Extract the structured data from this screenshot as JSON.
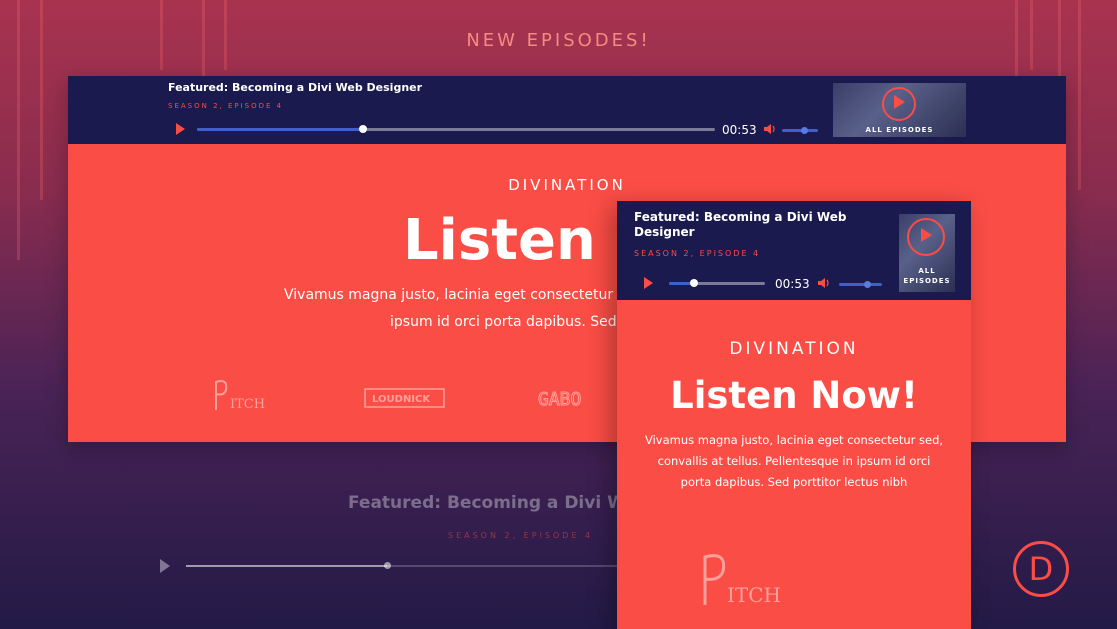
{
  "banner": {
    "title": "NEW EPISODES!"
  },
  "colors": {
    "accent": "#fa4d45",
    "player_bg": "#1a1a4e",
    "progress": "#3f5fcc"
  },
  "desktop": {
    "player": {
      "title": "Featured: Becoming a Divi Web Designer",
      "subtitle": "SEASON 2, EPISODE 4",
      "time": "00:53",
      "progress_fraction": 0.32,
      "volume_fraction": 0.6,
      "thumb_label": "ALL EPISODES"
    },
    "kicker": "DIVINATION",
    "hero": "Listen N",
    "body_line1": "Vivamus magna justo, lacinia eget consectetur sed",
    "body_line2": "ipsum id orci porta dapibus. Sed p",
    "logos": [
      "ITCH",
      "LOUDNICK",
      "GABO"
    ]
  },
  "mobile": {
    "player": {
      "title_line1": "Featured: Becoming a Divi Web",
      "title_line2": "Designer",
      "subtitle": "SEASON 2, EPISODE 4",
      "time": "00:53",
      "progress_fraction": 0.26,
      "volume_fraction": 0.65,
      "thumb_label_line1": "ALL",
      "thumb_label_line2": "EPISODES"
    },
    "kicker": "DIVINATION",
    "hero": "Listen Now!",
    "body_line1": "Vivamus magna justo, lacinia eget consectetur sed,",
    "body_line2": "convallis at tellus. Pellentesque in ipsum id orci",
    "body_line3": "porta dapibus. Sed porttitor lectus nibh",
    "logo": "ITCH"
  },
  "ghost_player": {
    "title": "Featured: Becoming a Divi Web",
    "subtitle": "SEASON 2, EPISODE 4"
  },
  "brand": {
    "letter": "D"
  }
}
